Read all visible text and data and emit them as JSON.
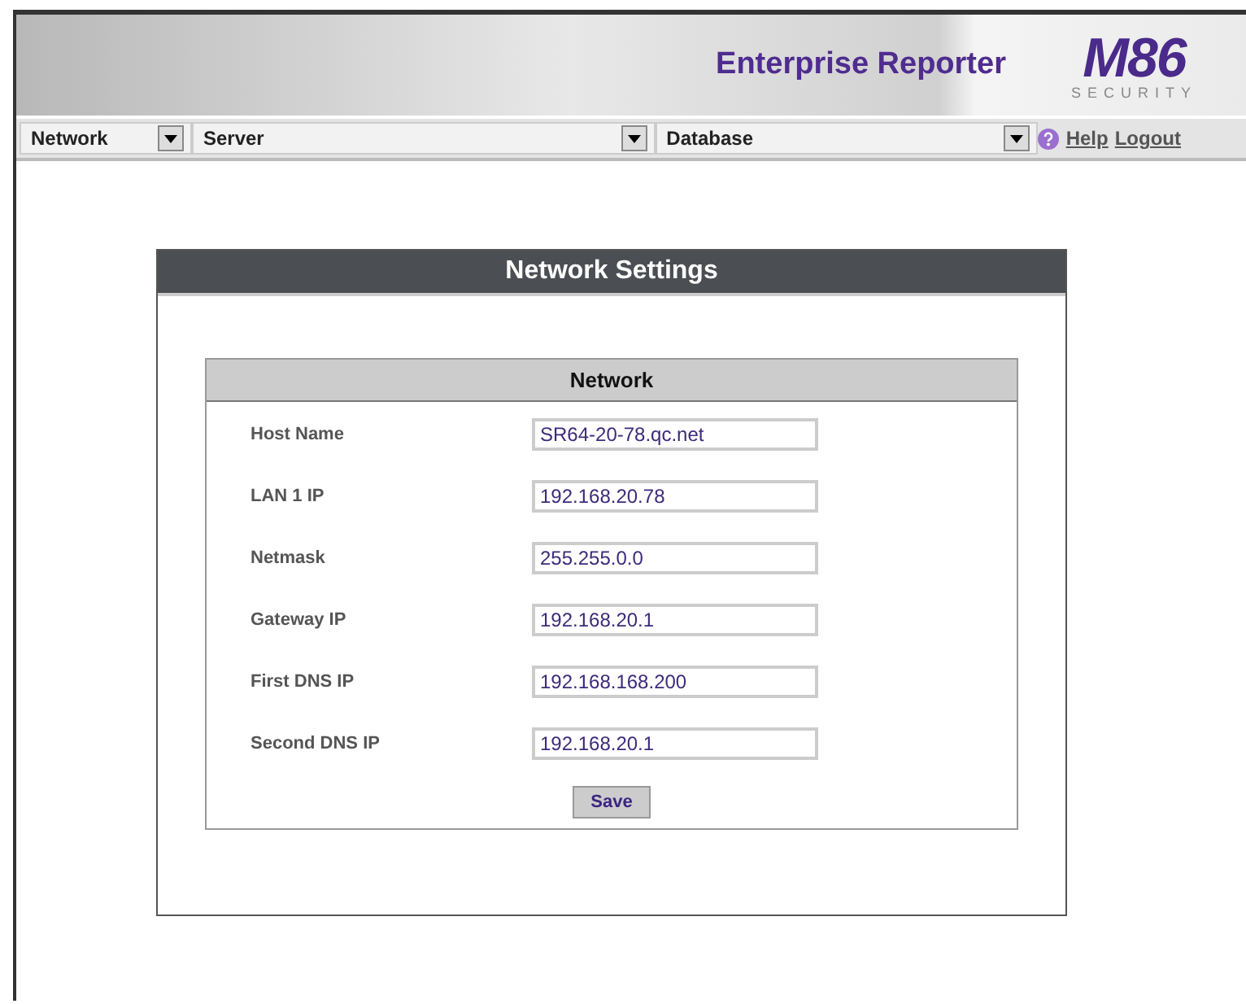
{
  "header": {
    "product": "Enterprise Reporter",
    "logo_mark": "M86",
    "logo_tagline": "SECURITY"
  },
  "nav": {
    "menus": [
      {
        "label": "Network"
      },
      {
        "label": "Server"
      },
      {
        "label": "Database"
      }
    ],
    "links": [
      {
        "label": "Help"
      },
      {
        "label": "Logout"
      }
    ]
  },
  "panel": {
    "title": "Network Settings",
    "section": "Network",
    "fields": [
      {
        "label": "Host Name",
        "value": "SR64-20-78.qc.net"
      },
      {
        "label": "LAN 1 IP",
        "value": "192.168.20.78"
      },
      {
        "label": "Netmask",
        "value": "255.255.0.0"
      },
      {
        "label": "Gateway IP",
        "value": "192.168.20.1"
      },
      {
        "label": "First DNS IP",
        "value": "192.168.168.200"
      },
      {
        "label": "Second DNS IP",
        "value": "192.168.20.1"
      }
    ],
    "button": "Save"
  }
}
